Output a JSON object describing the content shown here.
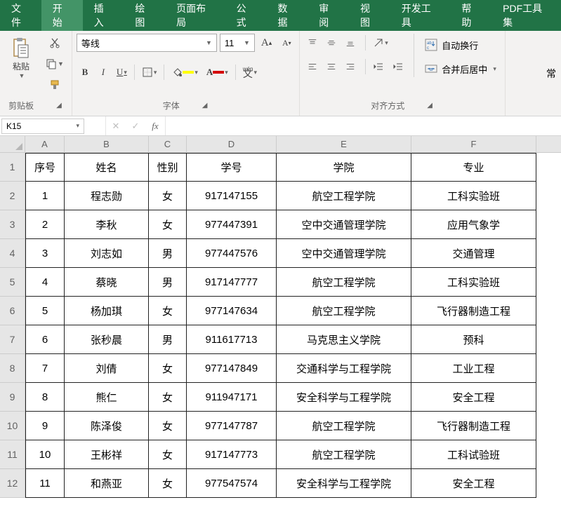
{
  "tabs": [
    "文件",
    "开始",
    "插入",
    "绘图",
    "页面布局",
    "公式",
    "数据",
    "审阅",
    "视图",
    "开发工具",
    "帮助",
    "PDF工具集"
  ],
  "active_tab_index": 1,
  "groups": {
    "clipboard": "剪贴板",
    "font": "字体",
    "alignment": "对齐方式",
    "paste": "粘贴",
    "wrap_text": "自动换行",
    "merge_center": "合并后居中"
  },
  "font": {
    "name": "等线",
    "size": "11"
  },
  "name_box": "K15",
  "formula": "",
  "columns": [
    "A",
    "B",
    "C",
    "D",
    "E",
    "F"
  ],
  "headers": {
    "A": "序号",
    "B": "姓名",
    "C": "性别",
    "D": "学号",
    "E": "学院",
    "F": "专业"
  },
  "rows": [
    {
      "n": "1",
      "A": "1",
      "B": "程志勋",
      "C": "女",
      "D": "917147155",
      "E": "航空工程学院",
      "F": "工科实验班"
    },
    {
      "n": "2",
      "A": "2",
      "B": "李秋",
      "C": "女",
      "D": "977447391",
      "E": "空中交通管理学院",
      "F": "应用气象学"
    },
    {
      "n": "3",
      "A": "3",
      "B": "刘志如",
      "C": "男",
      "D": "977447576",
      "E": "空中交通管理学院",
      "F": "交通管理"
    },
    {
      "n": "4",
      "A": "4",
      "B": "蔡晓",
      "C": "男",
      "D": "917147777",
      "E": "航空工程学院",
      "F": "工科实验班"
    },
    {
      "n": "5",
      "A": "5",
      "B": "杨加琪",
      "C": "女",
      "D": "977147634",
      "E": "航空工程学院",
      "F": "飞行器制造工程"
    },
    {
      "n": "6",
      "A": "6",
      "B": "张秒晨",
      "C": "男",
      "D": "911617713",
      "E": "马克思主义学院",
      "F": "预科"
    },
    {
      "n": "7",
      "A": "7",
      "B": "刘倩",
      "C": "女",
      "D": "977147849",
      "E": "交通科学与工程学院",
      "F": "工业工程"
    },
    {
      "n": "8",
      "A": "8",
      "B": "熊仁",
      "C": "女",
      "D": "911947171",
      "E": "安全科学与工程学院",
      "F": "安全工程"
    },
    {
      "n": "9",
      "A": "9",
      "B": "陈泽俊",
      "C": "女",
      "D": "977147787",
      "E": "航空工程学院",
      "F": "飞行器制造工程"
    },
    {
      "n": "10",
      "A": "10",
      "B": "王彬祥",
      "C": "女",
      "D": "917147773",
      "E": "航空工程学院",
      "F": "工科试验班"
    },
    {
      "n": "11",
      "A": "11",
      "B": "和燕亚",
      "C": "女",
      "D": "977547574",
      "E": "安全科学与工程学院",
      "F": "安全工程"
    }
  ]
}
